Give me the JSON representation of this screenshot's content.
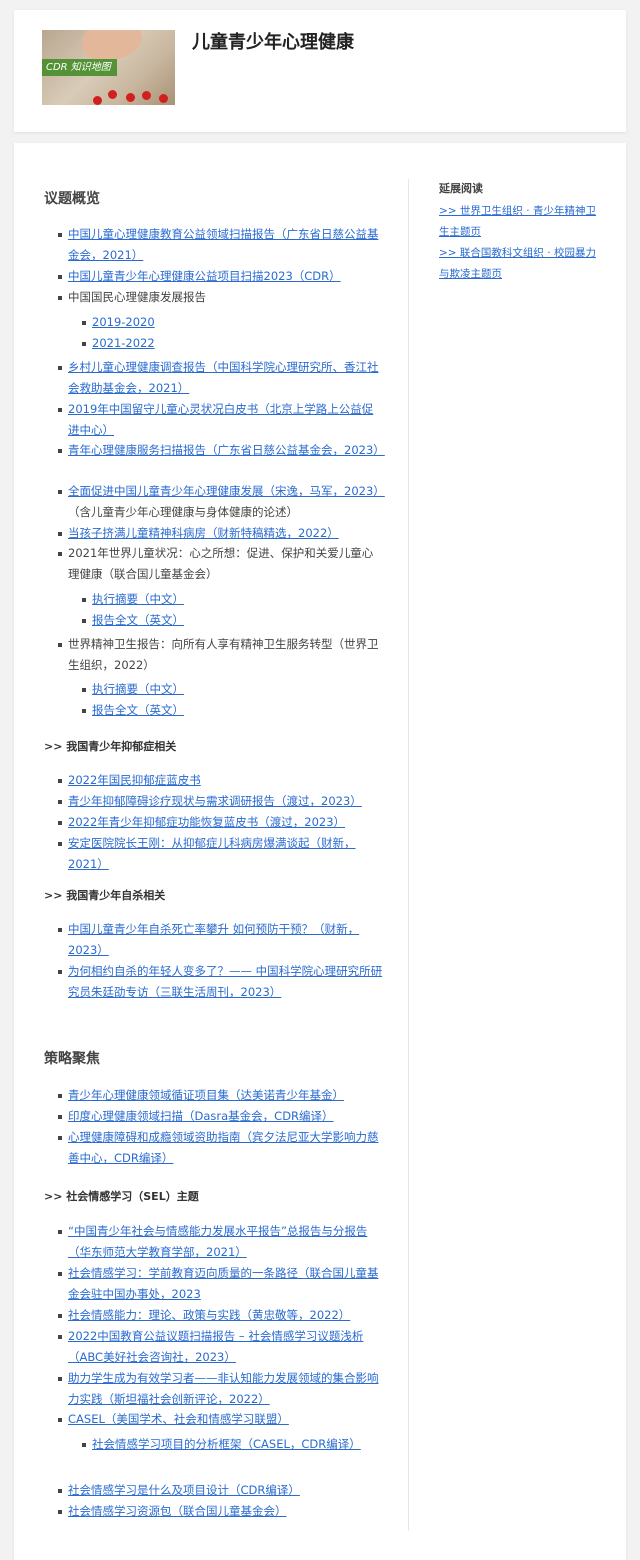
{
  "header": {
    "title": "儿童青少年心理健康",
    "thumb_tag": "CDR 知识地图"
  },
  "overview": {
    "title": "议题概览",
    "items": [
      {
        "text": "中国儿童心理健康教育公益领域扫描报告（广东省日慈公益基金会，2021）",
        "link": true
      },
      {
        "text": "中国儿童青少年心理健康公益项目扫描2023（CDR）",
        "link": true
      },
      {
        "text": "中国国民心理健康发展报告",
        "link": false
      },
      {
        "text": "2019-2020",
        "link": true
      },
      {
        "text": "2021-2022",
        "link": true
      },
      {
        "text": "乡村儿童心理健康调查报告（中国科学院心理研究所、香江社会救助基金会，2021）",
        "link": true
      },
      {
        "text": "2019年中国留守儿童心灵状况白皮书（北京上学路上公益促进中心）",
        "link": true
      },
      {
        "text": "青年心理健康服务扫描报告（广东省日慈公益基金会，2023）",
        "link": true
      },
      {
        "text": "全面促进中国儿童青少年心理健康发展（宋逸，马军，2023）",
        "link": true,
        "note": "（含儿童青少年心理健康与身体健康的论述）"
      },
      {
        "text": "当孩子挤满儿童精神科病房（财新特稿精选，2022）",
        "link": true
      },
      {
        "text": "2021年世界儿童状况：心之所想：促进、保护和关爱儿童心理健康（联合国儿童基金会）",
        "link": false
      },
      {
        "text": "执行摘要（中文）",
        "link": true
      },
      {
        "text": "报告全文（英文）",
        "link": true
      },
      {
        "text": "世界精神卫生报告：向所有人享有精神卫生服务转型（世界卫生组织，2022）",
        "link": false
      },
      {
        "text": "执行摘要（中文）",
        "link": true
      },
      {
        "text": "报告全文（英文）",
        "link": true
      }
    ]
  },
  "depression": {
    "title": ">> 我国青少年抑郁症相关",
    "items": [
      {
        "text": "2022年国民抑郁症蓝皮书",
        "link": true
      },
      {
        "text": "青少年抑郁障碍诊疗现状与需求调研报告（渡过，2023）",
        "link": true
      },
      {
        "text": "2022年青少年抑郁症功能恢复蓝皮书（渡过，2023）",
        "link": true
      },
      {
        "text": "安定医院院长王刚：从抑郁症儿科病房爆满谈起（财新，2021）",
        "link": true
      }
    ]
  },
  "suicide": {
    "title": ">> 我国青少年自杀相关",
    "items": [
      {
        "text": "中国儿童青少年自杀死亡率攀升 如何预防干预？（财新，2023）",
        "link": true
      },
      {
        "text": "为何相约自杀的年轻人变多了？—— 中国科学院心理研究所研究员朱廷劭专访（三联生活周刊，2023）",
        "link": true
      }
    ]
  },
  "strategy": {
    "title": "策略聚焦",
    "items": [
      {
        "text": "青少年心理健康领域循证项目集（达美诺青少年基金）",
        "link": true
      },
      {
        "text": "印度心理健康领域扫描（Dasra基金会，CDR编译）",
        "link": true
      },
      {
        "text": "心理健康障碍和成瘾领域资助指南（宾夕法尼亚大学影响力慈善中心，CDR编译）",
        "link": true
      }
    ]
  },
  "sel": {
    "title": ">> 社会情感学习（SEL）主题",
    "items": [
      {
        "text": "“中国青少年社会与情感能力发展水平报告”总报告与分报告（华东师范大学教育学部，2021）",
        "link": true
      },
      {
        "text": "社会情感学习：学前教育迈向质量的一条路径（联合国儿童基金会驻中国办事处，2023",
        "link": true
      },
      {
        "text": "社会情感能力：理论、政策与实践（黄忠敬等，2022）",
        "link": true
      },
      {
        "text": "2022中国教育公益议题扫描报告 – 社会情感学习议题浅析（ABC美好社会咨询社，2023）",
        "link": true
      },
      {
        "text": "助力学生成为有效学习者——非认知能力发展领域的集合影响力实践（斯坦福社会创新评论，2022）",
        "link": true
      },
      {
        "text": "CASEL（美国学术、社会和情感学习联盟）",
        "link": true
      },
      {
        "text": "社会情感学习项目的分析框架（CASEL，CDR编译）",
        "link": true
      },
      {
        "text": "社会情感学习是什么及项目设计（CDR编译）",
        "link": true
      },
      {
        "text": "社会情感学习资源包（联合国儿童基金会）",
        "link": true
      }
    ]
  },
  "sidebar": {
    "title": "延展阅读",
    "links": [
      ">> 世界卫生组织 · 青少年精神卫生主题页",
      ">> 联合国教科文组织 · 校园暴力与欺凌主题页"
    ]
  }
}
